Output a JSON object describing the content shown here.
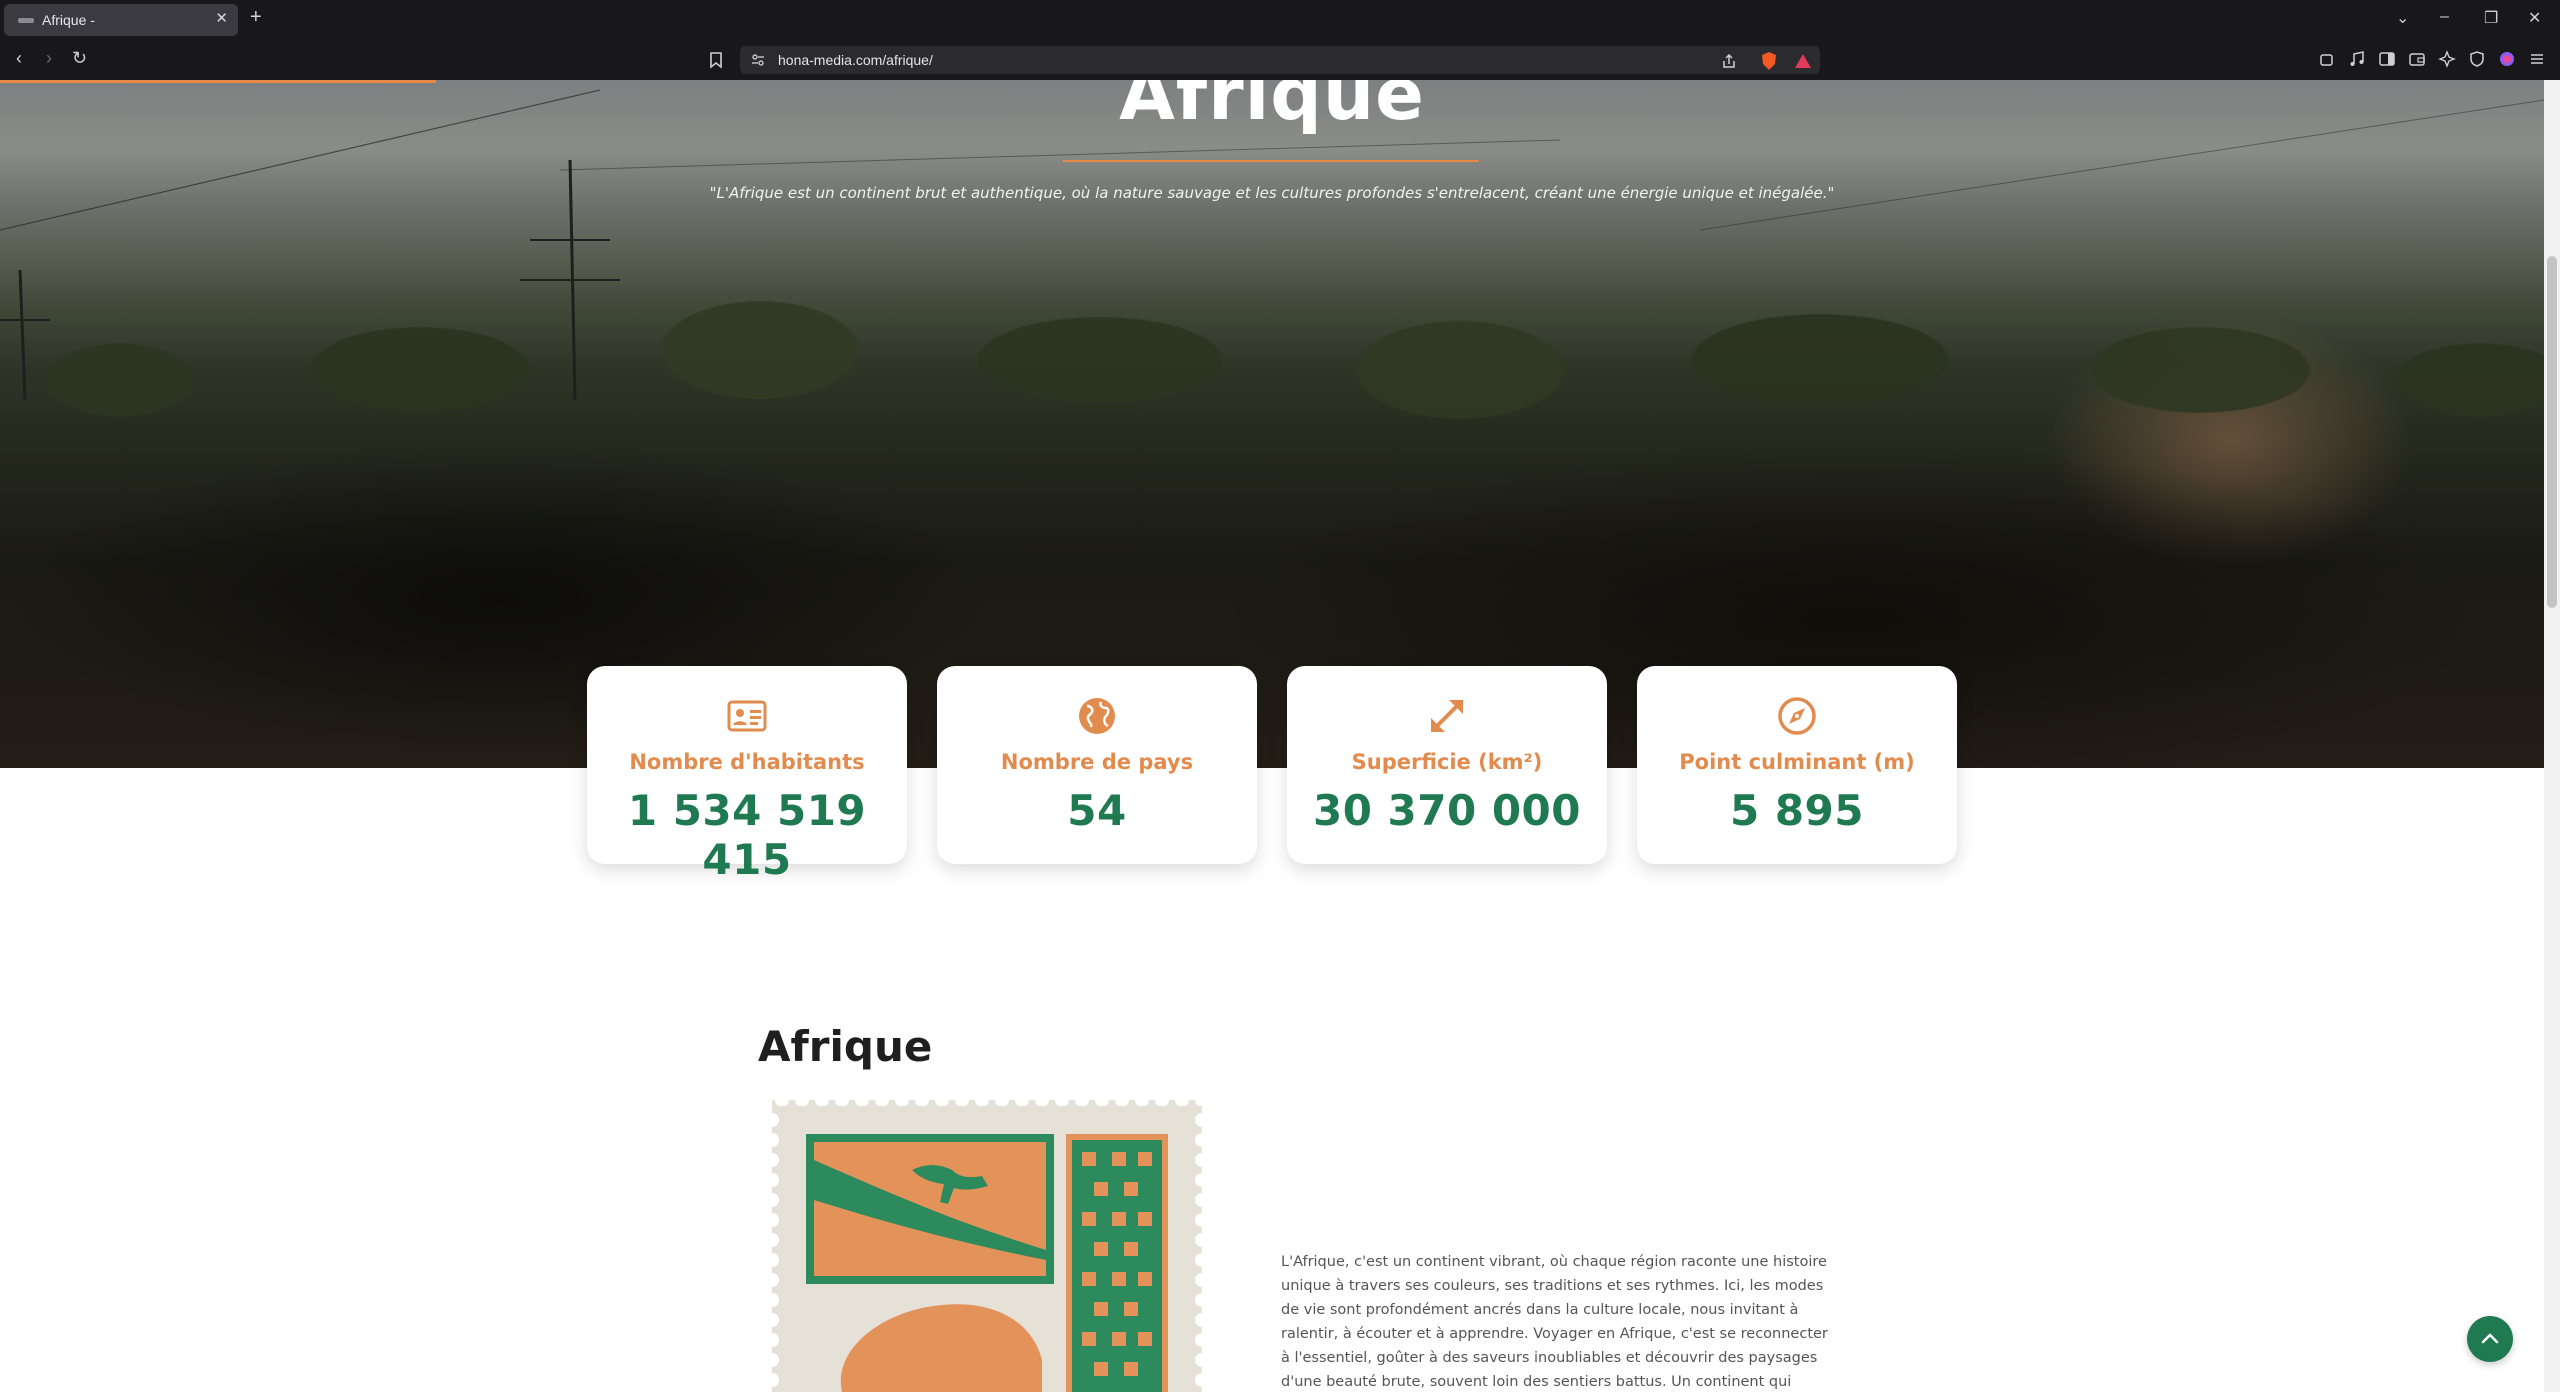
{
  "browser": {
    "tab_title": "Afrique -",
    "tab_close": "✕",
    "new_tab": "+",
    "url": "hona-media.com/afrique/",
    "controls": {
      "dropdown": "⌄",
      "minimize": "–",
      "restore": "❐",
      "close": "✕"
    },
    "nav": {
      "back": "‹",
      "forward": "›",
      "reload": "↻"
    }
  },
  "hero": {
    "title": "Afrique",
    "quote": "\"L'Afrique est un continent brut et authentique, où la nature sauvage et les cultures profondes s'entrelacent, créant une énergie unique et inégalée.\""
  },
  "stats": [
    {
      "label": "Nombre d'habitants",
      "value": "1 534 519 415",
      "icon": "id-card-icon"
    },
    {
      "label": "Nombre de pays",
      "value": "54",
      "icon": "globe-icon"
    },
    {
      "label": "Superficie (km²)",
      "value": "30 370 000",
      "icon": "expand-arrows-icon"
    },
    {
      "label": "Point culminant (m)",
      "value": "5 895",
      "icon": "compass-icon"
    }
  ],
  "section": {
    "title": "Afrique",
    "body": "L'Afrique, c'est un continent vibrant, où chaque région raconte une histoire unique à travers ses couleurs, ses traditions et ses rythmes. Ici, les modes de vie sont profondément ancrés dans la culture locale, nous invitant à ralentir, à écouter et à apprendre. Voyager en Afrique, c'est se reconnecter à l'essentiel, goûter à des saveurs inoubliables et découvrir des paysages d'une beauté brute, souvent loin des sentiers battus. Un continent qui touche l'âme et change notre"
  },
  "colors": {
    "accent_orange": "#e28b4f",
    "accent_green": "#1f7a52",
    "browser_chrome": "#18181b"
  },
  "back_to_top": "⌃"
}
